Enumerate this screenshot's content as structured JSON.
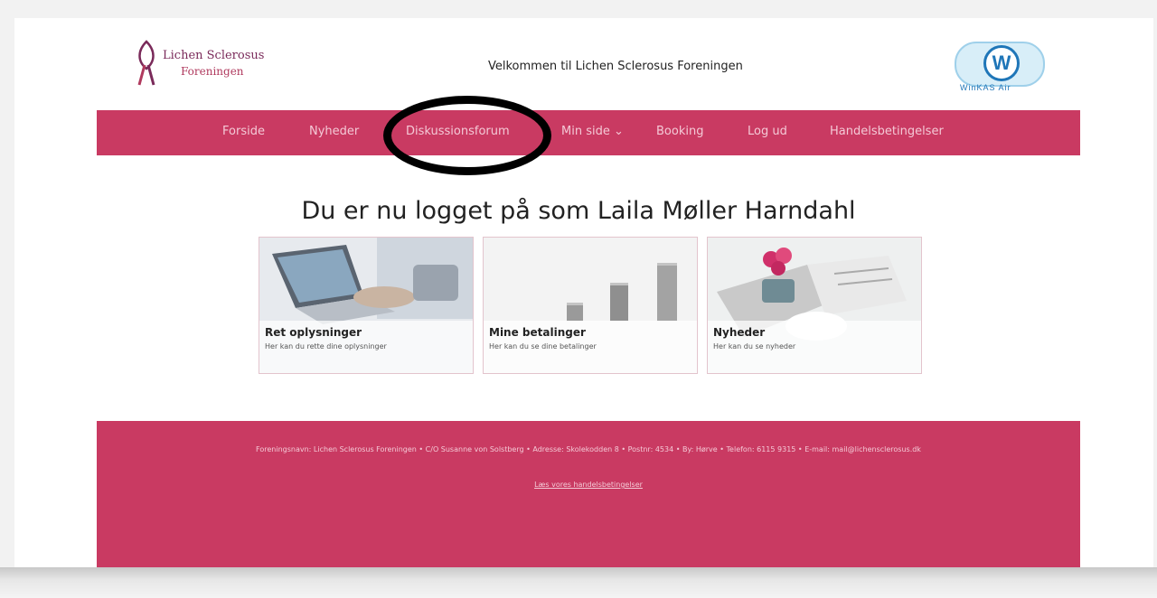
{
  "header": {
    "logo_line1": "Lichen Sclerosus",
    "logo_line2": "Foreningen",
    "title": "Velkommen til Lichen Sclerosus Foreningen",
    "partner_logo_label": "WinKAS Air"
  },
  "nav": {
    "items": [
      {
        "label": "Forside"
      },
      {
        "label": "Nyheder"
      },
      {
        "label": "Diskussionsforum"
      },
      {
        "label": "Min side ⌄"
      },
      {
        "label": "Booking"
      },
      {
        "label": "Log ud"
      },
      {
        "label": "Handelsbetingelser"
      }
    ]
  },
  "main": {
    "headline": "Du er nu logget på som Laila Møller Harndahl",
    "cards": [
      {
        "title": "Ret oplysninger",
        "desc": "Her kan du rette dine oplysninger"
      },
      {
        "title": "Mine betalinger",
        "desc": "Her kan du se dine betalinger"
      },
      {
        "title": "Nyheder",
        "desc": "Her kan du se nyheder"
      }
    ]
  },
  "footer": {
    "info": "Foreningsnavn: Lichen Sclerosus Foreningen • C/O Susanne von Solstberg • Adresse: Skolekodden 8 • Postnr: 4534 • By: Hørve • Telefon: 6115 9315 • E-mail: mail@lichensclerosus.dk",
    "link": "Læs vores handelsbetingelser"
  },
  "colors": {
    "brand": "#c93a62",
    "annotation_ring": "#000000"
  }
}
